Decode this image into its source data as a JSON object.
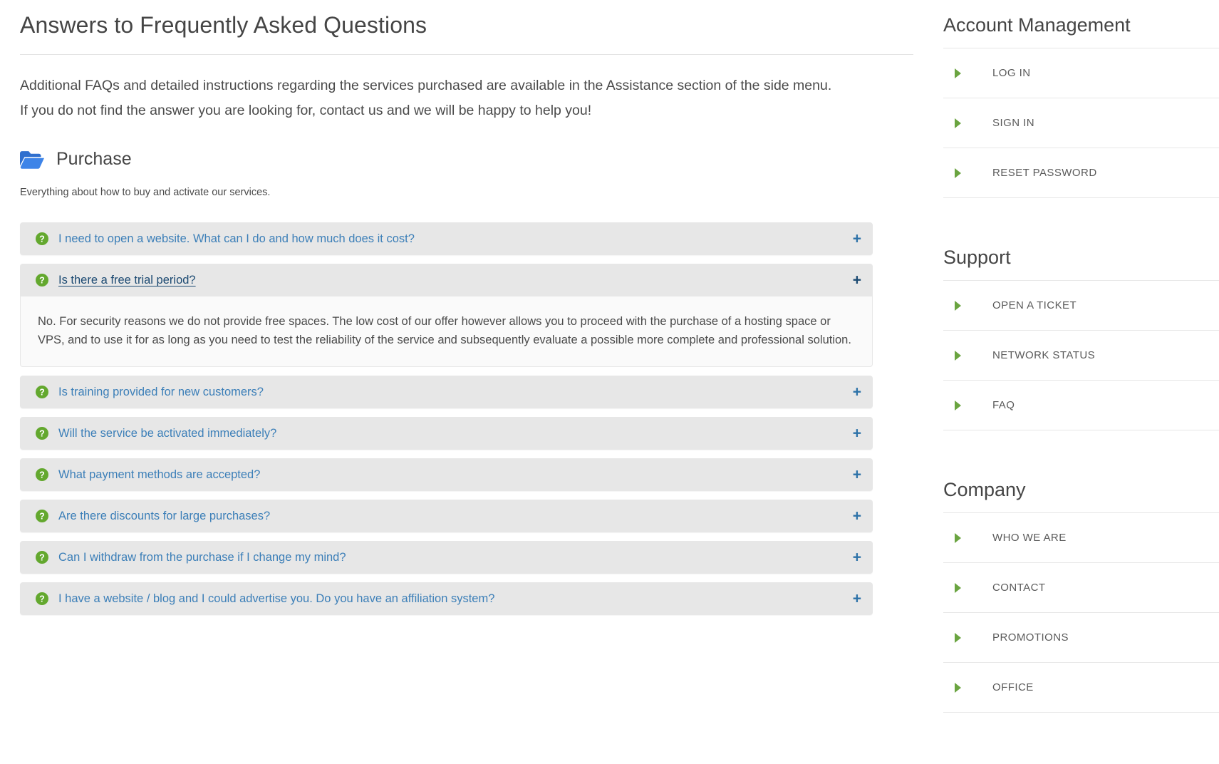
{
  "main": {
    "title": "Answers to Frequently Asked Questions",
    "intro_line1": "Additional FAQs and detailed instructions regarding the services purchased are available in the Assistance section of the side menu.",
    "intro_line2": "If you do not find the answer you are looking for, contact us and we will be happy to help you!",
    "section": {
      "icon": "folder-open-icon",
      "title": "Purchase",
      "description": "Everything about how to buy and activate our services."
    },
    "expand_label": "+",
    "question_icon": "question-circle-icon",
    "faqs": [
      {
        "question": "I need to open a website. What can I do and how much does it cost?",
        "open": false,
        "answer": ""
      },
      {
        "question": "Is there a free trial period?",
        "open": true,
        "answer": "No. For security reasons we do not provide free spaces. The low cost of our offer however allows you to proceed with the purchase of a hosting space or VPS, and to use it for as long as you need to test the reliability of the service and subsequently evaluate a possible more complete and professional solution."
      },
      {
        "question": "Is training provided for new customers?",
        "open": false,
        "answer": ""
      },
      {
        "question": "Will the service be activated immediately?",
        "open": false,
        "answer": ""
      },
      {
        "question": "What payment methods are accepted?",
        "open": false,
        "answer": ""
      },
      {
        "question": "Are there discounts for large purchases?",
        "open": false,
        "answer": ""
      },
      {
        "question": "Can I withdraw from the purchase if I change my mind?",
        "open": false,
        "answer": ""
      },
      {
        "question": "I have a website / blog and I could advertise you. Do you have an affiliation system?",
        "open": false,
        "answer": ""
      }
    ]
  },
  "sidebar": {
    "blocks": [
      {
        "title": "Account Management",
        "items": [
          {
            "label": "LOG IN"
          },
          {
            "label": "SIGN IN"
          },
          {
            "label": "RESET PASSWORD"
          }
        ]
      },
      {
        "title": "Support",
        "items": [
          {
            "label": "OPEN A TICKET"
          },
          {
            "label": "NETWORK STATUS"
          },
          {
            "label": "FAQ"
          }
        ]
      },
      {
        "title": "Company",
        "items": [
          {
            "label": "WHO WE ARE"
          },
          {
            "label": "CONTACT"
          },
          {
            "label": "PROMOTIONS"
          },
          {
            "label": "OFFICE"
          }
        ]
      }
    ],
    "bullet_icon": "triangle-right-icon"
  },
  "colors": {
    "accent_green": "#6aa440",
    "link_blue": "#3c7fb8",
    "link_blue_active": "#1c4a72",
    "folder_blue": "#2f6fce",
    "panel_gray": "#e7e7e7",
    "answer_bg": "#fafafa",
    "text_gray": "#4a4a4a"
  }
}
